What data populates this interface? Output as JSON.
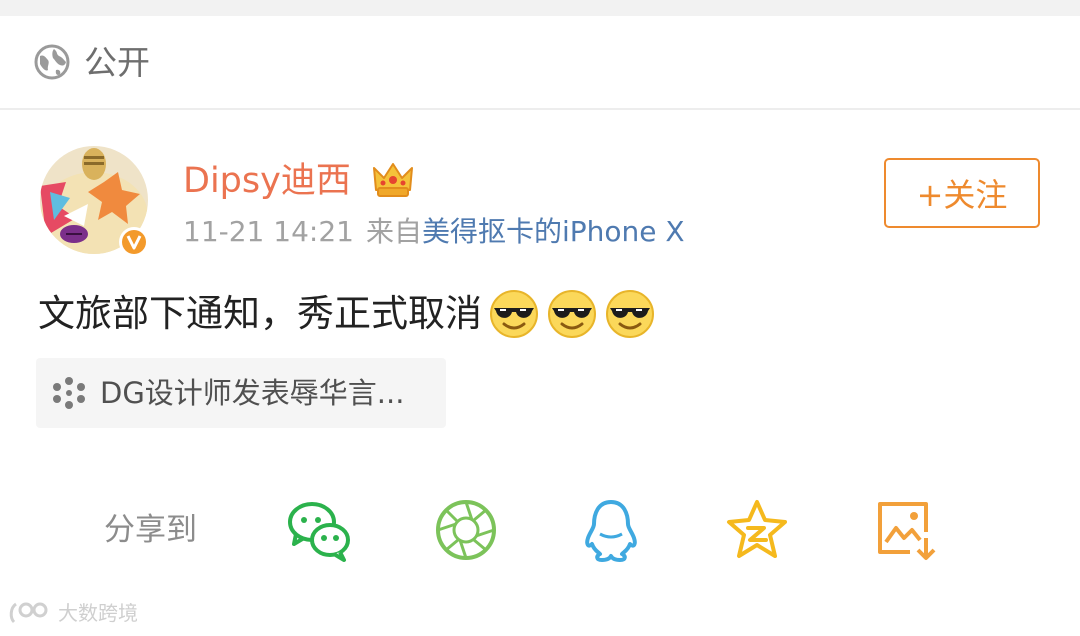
{
  "visibility": {
    "label": "公开",
    "icon": "globe-icon"
  },
  "post": {
    "author": "Dipsy迪西",
    "time": "11-21 14:21",
    "source_prefix": "来自",
    "source_device": "美得抠卡的iPhone X",
    "text": "文旅部下通知，秀正式取消",
    "emoji_count": 3,
    "emoji_icon": "sunglasses-emoji-icon",
    "follow_label": "+关注",
    "topic_label": "DG设计师发表辱华言..."
  },
  "share": {
    "label": "分享到",
    "targets": [
      "wechat-icon",
      "moments-icon",
      "qq-icon",
      "qzone-icon",
      "save-image-icon"
    ]
  },
  "watermark": {
    "text": "大数跨境"
  },
  "colors": {
    "accent_orange": "#eb7350",
    "link_blue": "#4f7ab0",
    "follow_border": "#ee8a2e"
  }
}
